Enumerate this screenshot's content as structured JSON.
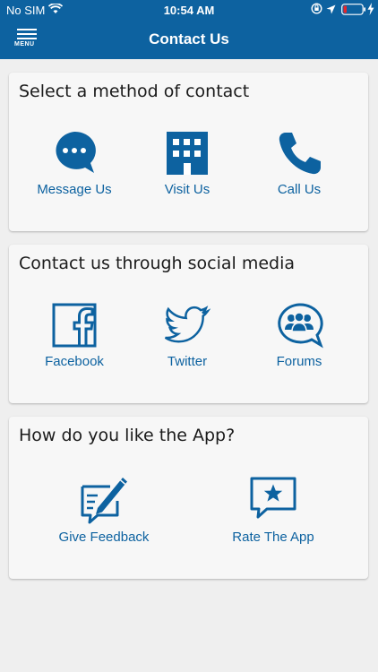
{
  "status_bar": {
    "carrier": "No SIM",
    "time": "10:54 AM",
    "icons": [
      "wifi-icon",
      "orientation-lock-icon",
      "location-icon",
      "battery-low-icon",
      "charging-icon"
    ],
    "battery_color": "#e4262b"
  },
  "header": {
    "menu_label": "MENU",
    "title": "Contact Us",
    "background": "#0d62a0"
  },
  "contact_methods": {
    "title": "Select a method of contact",
    "items": [
      {
        "label": "Message Us",
        "icon": "chat-bubble-icon"
      },
      {
        "label": "Visit Us",
        "icon": "building-icon"
      },
      {
        "label": "Call Us",
        "icon": "phone-icon"
      }
    ]
  },
  "social_media": {
    "title": "Contact us through social media",
    "items": [
      {
        "label": "Facebook",
        "icon": "facebook-icon"
      },
      {
        "label": "Twitter",
        "icon": "twitter-icon"
      },
      {
        "label": "Forums",
        "icon": "forums-icon"
      }
    ]
  },
  "app_feedback": {
    "title": "How do you like the App?",
    "items": [
      {
        "label": "Give Feedback",
        "icon": "feedback-pencil-icon"
      },
      {
        "label": "Rate The App",
        "icon": "star-bubble-icon"
      }
    ]
  },
  "accent_color": "#0d62a0"
}
